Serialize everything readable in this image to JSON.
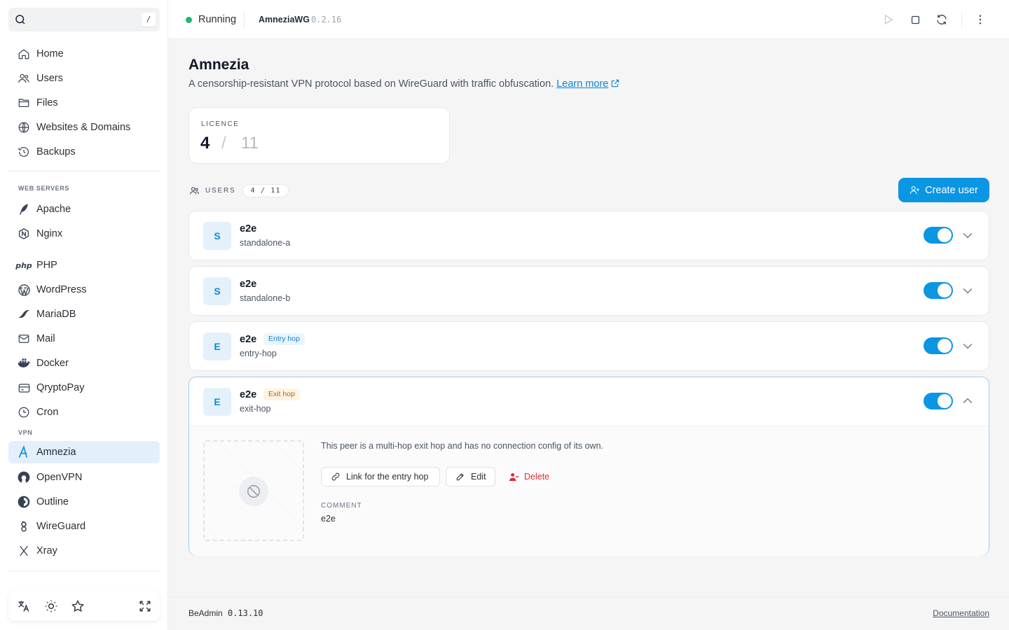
{
  "search": {
    "shortcut": "/"
  },
  "sidebar": {
    "items_main": [
      {
        "label": "Home",
        "icon": "home-icon"
      },
      {
        "label": "Users",
        "icon": "users-icon"
      },
      {
        "label": "Files",
        "icon": "folder-icon"
      },
      {
        "label": "Websites & Domains",
        "icon": "globe-icon"
      },
      {
        "label": "Backups",
        "icon": "history-icon"
      }
    ],
    "section_web": "WEB SERVERS",
    "items_web": [
      {
        "label": "Apache",
        "icon": "feather-icon"
      },
      {
        "label": "Nginx",
        "icon": "nginx-icon"
      }
    ],
    "items_apps": [
      {
        "label": "PHP",
        "icon": "php-icon"
      },
      {
        "label": "WordPress",
        "icon": "wordpress-icon"
      },
      {
        "label": "MariaDB",
        "icon": "mariadb-icon"
      },
      {
        "label": "Mail",
        "icon": "mail-icon"
      },
      {
        "label": "Docker",
        "icon": "docker-icon"
      },
      {
        "label": "QryptoPay",
        "icon": "card-icon"
      },
      {
        "label": "Cron",
        "icon": "clock-icon"
      }
    ],
    "section_vpn": "VPN",
    "items_vpn": [
      {
        "label": "Amnezia",
        "icon": "amnezia-icon",
        "active": true
      },
      {
        "label": "OpenVPN",
        "icon": "openvpn-icon"
      },
      {
        "label": "Outline",
        "icon": "outline-icon"
      },
      {
        "label": "WireGuard",
        "icon": "wireguard-icon"
      },
      {
        "label": "Xray",
        "icon": "xray-icon"
      }
    ]
  },
  "topbar": {
    "status": "Running",
    "service_name": "AmneziaWG",
    "service_version": "0.2.16",
    "status_color": "#22b573"
  },
  "page": {
    "title": "Amnezia",
    "description": "A censorship-resistant VPN protocol based on WireGuard with traffic obfuscation.",
    "learn_more": "Learn more"
  },
  "licence": {
    "label": "LICENCE",
    "used": "4",
    "separator": "/",
    "max": "11"
  },
  "users_section": {
    "label": "USERS",
    "count": "4 / 11",
    "create_label": "Create user"
  },
  "users": [
    {
      "initial": "S",
      "name": "e2e",
      "sub": "standalone-a",
      "tag": "",
      "enabled": true
    },
    {
      "initial": "S",
      "name": "e2e",
      "sub": "standalone-b",
      "tag": "",
      "enabled": true
    },
    {
      "initial": "E",
      "name": "e2e",
      "sub": "entry-hop",
      "tag": "Entry hop",
      "enabled": true
    },
    {
      "initial": "E",
      "name": "e2e",
      "sub": "exit-hop",
      "tag": "Exit hop",
      "enabled": true,
      "expanded": true
    }
  ],
  "expanded": {
    "note": "This peer is a multi-hop exit hop and has no connection config of its own.",
    "link_label": "Link for the entry hop",
    "edit_label": "Edit",
    "delete_label": "Delete",
    "comment_label": "COMMENT",
    "comment_value": "e2e"
  },
  "footer": {
    "brand": "BeAdmin",
    "version": "0.13.10",
    "docs": "Documentation"
  },
  "colors": {
    "accent": "#0a96e3",
    "active_bg": "#e3f0fb",
    "danger": "#dc2f3c"
  }
}
